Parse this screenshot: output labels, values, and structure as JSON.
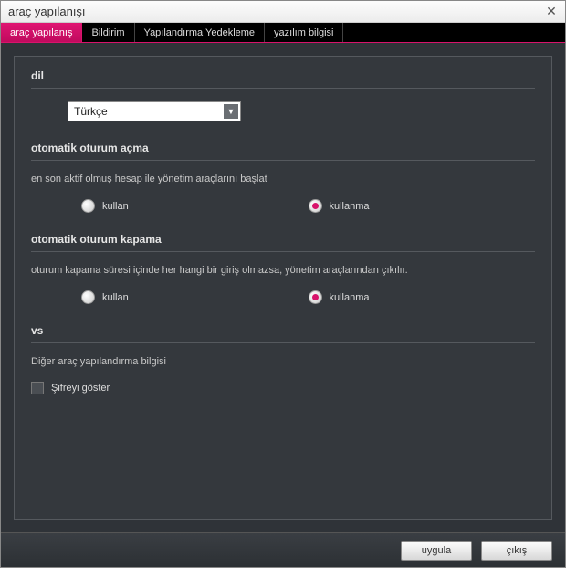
{
  "window": {
    "title": "araç yapılanışı"
  },
  "tabs": [
    {
      "label": "araç yapılanış",
      "active": true
    },
    {
      "label": "Bildirim",
      "active": false
    },
    {
      "label": "Yapılandırma Yedekleme",
      "active": false
    },
    {
      "label": "yazılım bilgisi",
      "active": false
    }
  ],
  "sections": {
    "language": {
      "title": "dil",
      "selected": "Türkçe"
    },
    "autoLogin": {
      "title": "otomatik oturum açma",
      "desc": "en son aktif olmuş hesap ile yönetim araçlarını başlat",
      "options": {
        "use": "kullan",
        "dontUse": "kullanma"
      },
      "selected": "dontUse"
    },
    "autoLogout": {
      "title": "otomatik oturum kapama",
      "desc": "oturum kapama süresi içinde her hangi bir giriş olmazsa, yönetim araçlarından çıkılır.",
      "options": {
        "use": "kullan",
        "dontUse": "kullanma"
      },
      "selected": "dontUse"
    },
    "misc": {
      "title": "vs",
      "desc": "Diğer araç yapılandırma bilgisi",
      "showPassword": "Şifreyi göster",
      "showPasswordChecked": false
    }
  },
  "footer": {
    "apply": "uygula",
    "exit": "çıkış"
  }
}
